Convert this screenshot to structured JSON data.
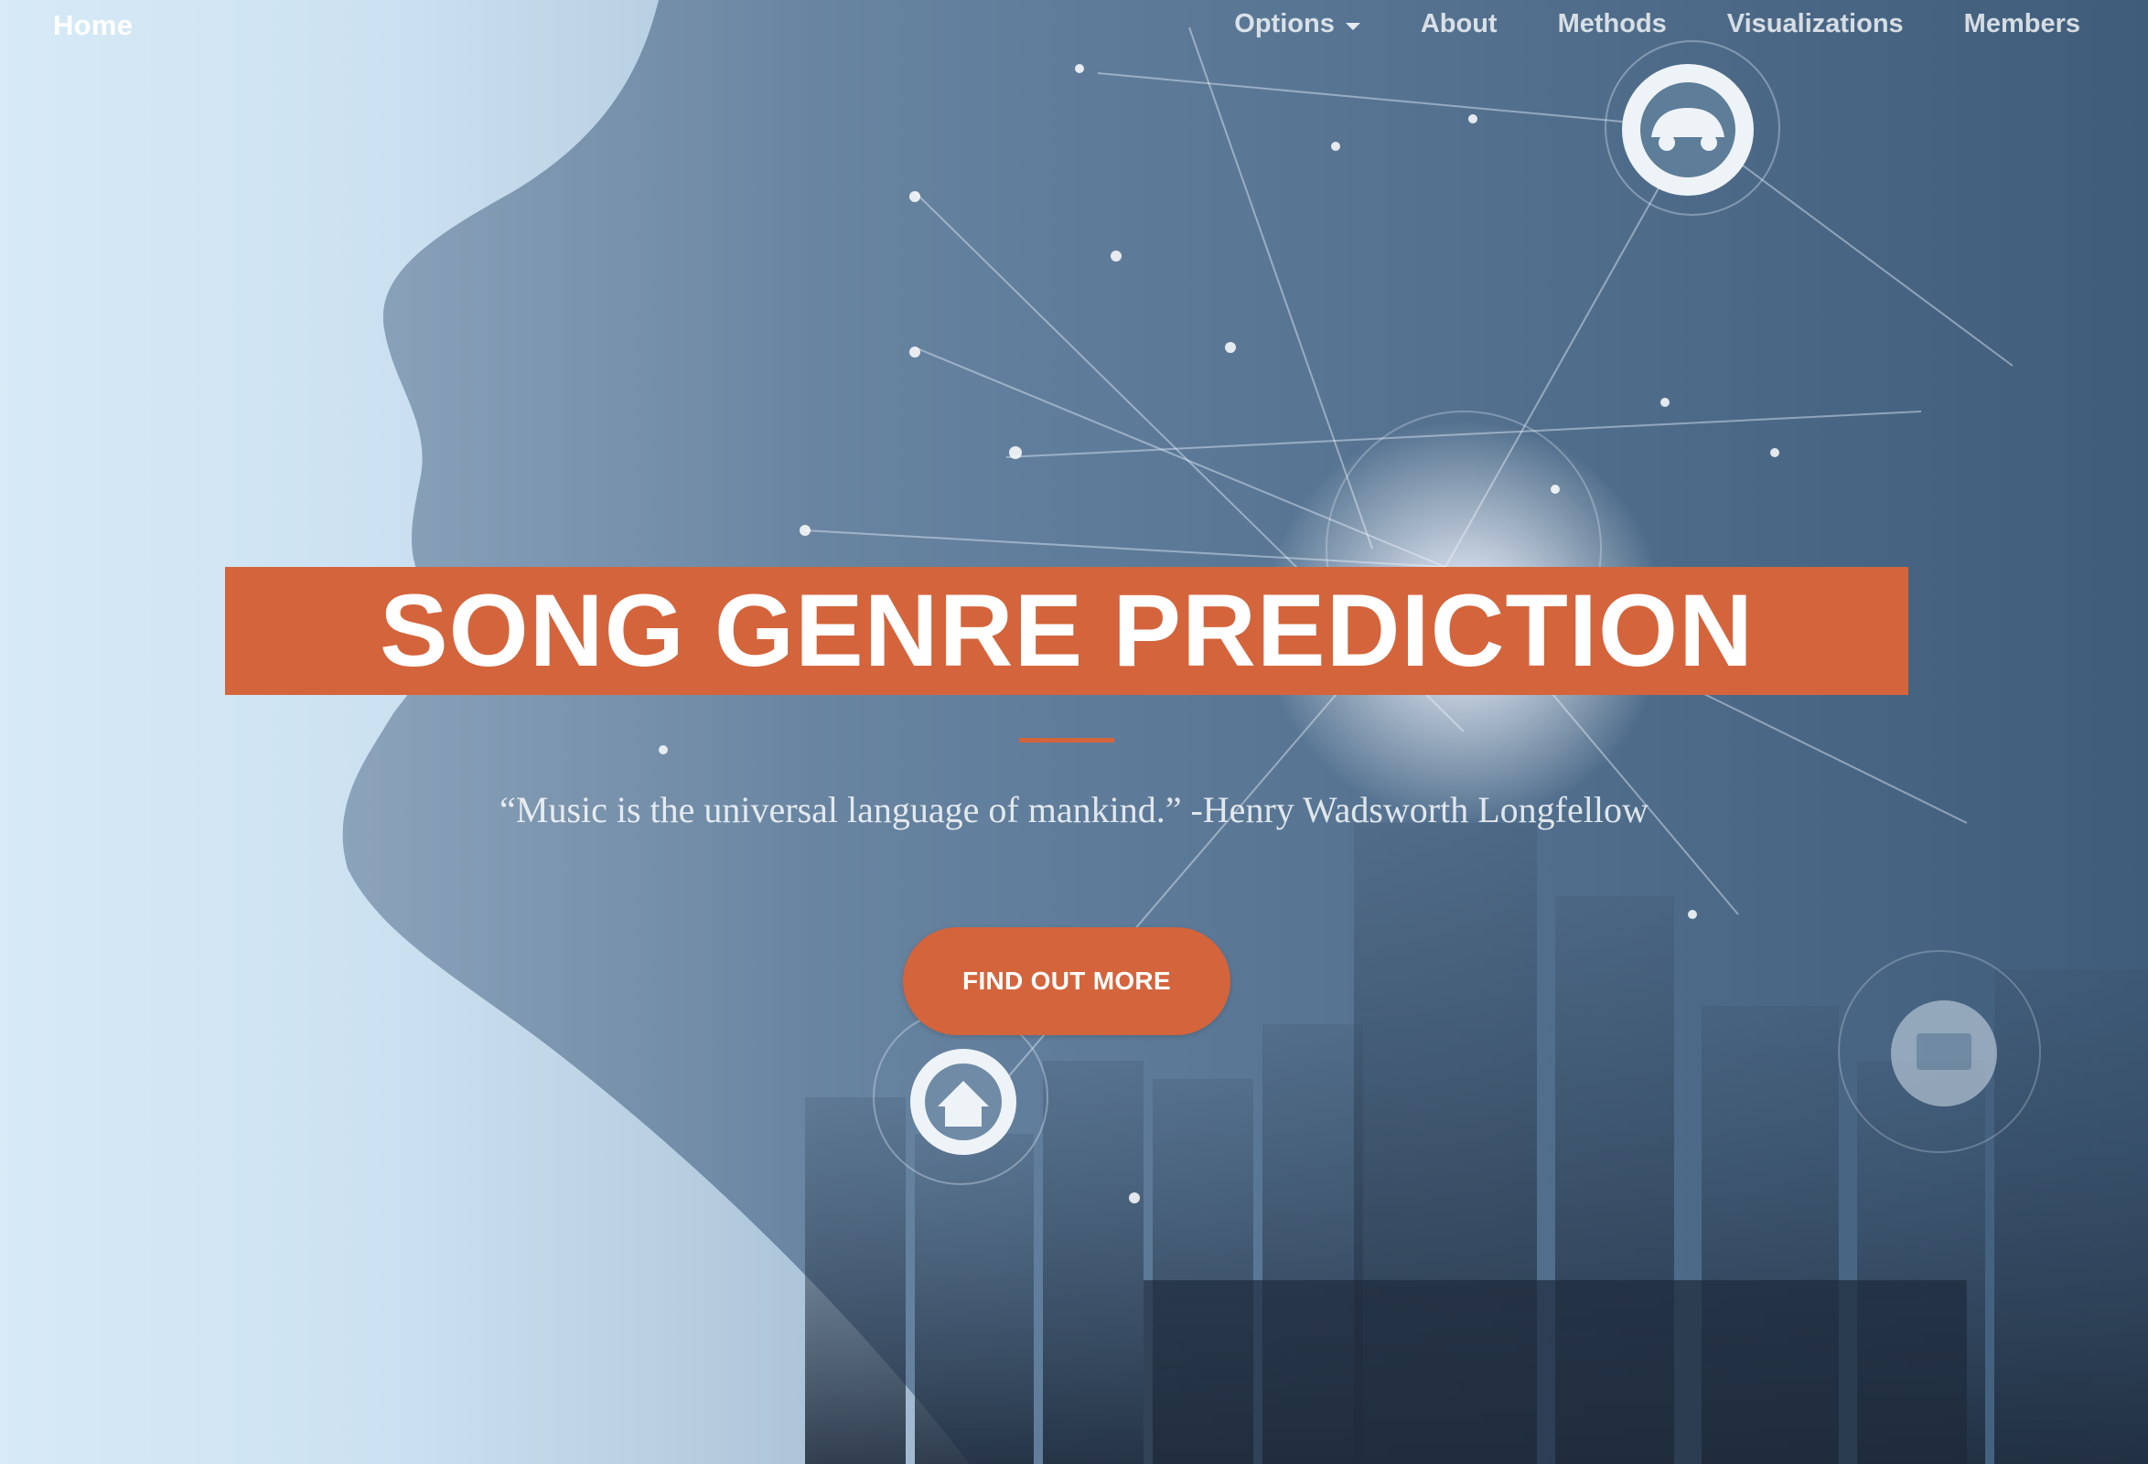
{
  "navbar": {
    "brand": "Home",
    "items": [
      {
        "label": "Options",
        "has_dropdown": true
      },
      {
        "label": "About"
      },
      {
        "label": "Methods"
      },
      {
        "label": "Visualizations"
      },
      {
        "label": "Members"
      }
    ]
  },
  "masthead": {
    "title": "SONG GENRE PREDICTION",
    "quote": "“Music is the universal language of mankind.” -Henry Wadsworth Longfellow",
    "cta_label": "FIND OUT MORE"
  },
  "colors": {
    "accent": "#d4643c",
    "nav_text": "#ffffff",
    "background_light": "#d6e9f6",
    "background_dark": "#46637f"
  },
  "icons": {
    "dropdown": "caret-down-icon",
    "car": "car-icon",
    "home": "home-icon",
    "monitor": "monitor-icon"
  }
}
